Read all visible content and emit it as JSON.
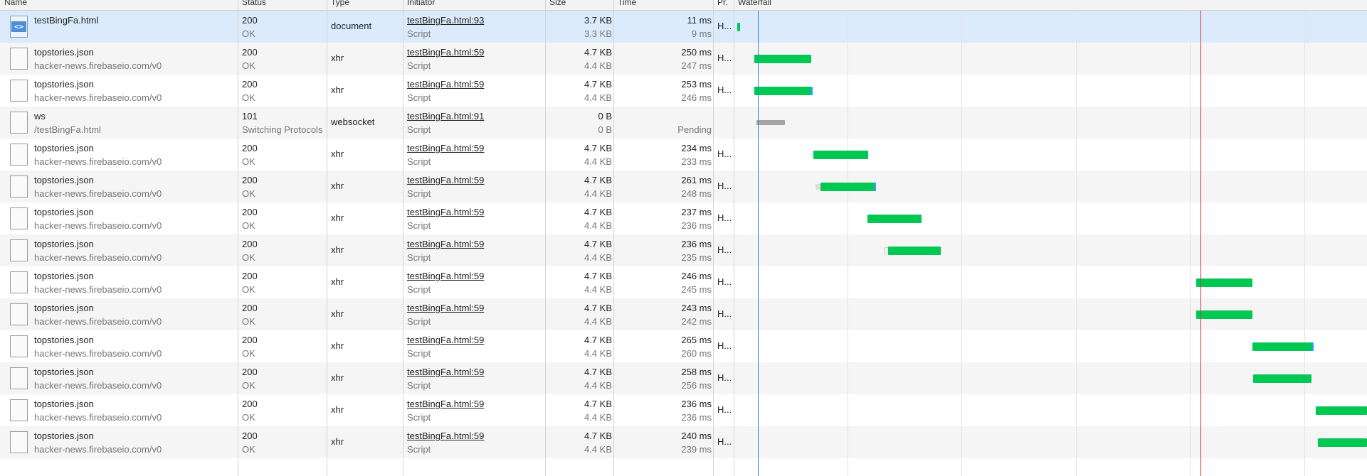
{
  "headers": {
    "name": "Name",
    "status": "Status",
    "type": "Type",
    "initiator": "Initiator",
    "size": "Size",
    "time": "Time",
    "protocol": "Pr.",
    "waterfall": "Waterfall"
  },
  "requests": [
    {
      "name": "testBingFa.html",
      "domain": "",
      "status": "200",
      "status_text": "OK",
      "type": "document",
      "initiator": "testBingFa.html:93",
      "initiator_type": "Script",
      "size": "3.7 KB",
      "resource": "3.3 KB",
      "time": "11 ms",
      "latency": "9 ms",
      "protocol": "H...",
      "icon": "html-document-icon"
    },
    {
      "name": "topstories.json",
      "domain": "hacker-news.firebaseio.com/v0",
      "status": "200",
      "status_text": "OK",
      "type": "xhr",
      "initiator": "testBingFa.html:59",
      "initiator_type": "Script",
      "size": "4.7 KB",
      "resource": "4.4 KB",
      "time": "250 ms",
      "latency": "247 ms",
      "protocol": "H...",
      "icon": "blank-file-icon"
    },
    {
      "name": "topstories.json",
      "domain": "hacker-news.firebaseio.com/v0",
      "status": "200",
      "status_text": "OK",
      "type": "xhr",
      "initiator": "testBingFa.html:59",
      "initiator_type": "Script",
      "size": "4.7 KB",
      "resource": "4.4 KB",
      "time": "253 ms",
      "latency": "246 ms",
      "protocol": "H...",
      "icon": "blank-file-icon"
    },
    {
      "name": "ws",
      "domain": "/testBingFa.html",
      "status": "101",
      "status_text": "Switching Protocols",
      "type": "websocket",
      "initiator": "testBingFa.html:91",
      "initiator_type": "Script",
      "size": "0 B",
      "resource": "0 B",
      "time": "",
      "latency": "Pending",
      "protocol": "",
      "icon": "blank-file-icon"
    },
    {
      "name": "topstories.json",
      "domain": "hacker-news.firebaseio.com/v0",
      "status": "200",
      "status_text": "OK",
      "type": "xhr",
      "initiator": "testBingFa.html:59",
      "initiator_type": "Script",
      "size": "4.7 KB",
      "resource": "4.4 KB",
      "time": "234 ms",
      "latency": "233 ms",
      "protocol": "H...",
      "icon": "blank-file-icon"
    },
    {
      "name": "topstories.json",
      "domain": "hacker-news.firebaseio.com/v0",
      "status": "200",
      "status_text": "OK",
      "type": "xhr",
      "initiator": "testBingFa.html:59",
      "initiator_type": "Script",
      "size": "4.7 KB",
      "resource": "4.4 KB",
      "time": "261 ms",
      "latency": "248 ms",
      "protocol": "H...",
      "icon": "blank-file-icon"
    },
    {
      "name": "topstories.json",
      "domain": "hacker-news.firebaseio.com/v0",
      "status": "200",
      "status_text": "OK",
      "type": "xhr",
      "initiator": "testBingFa.html:59",
      "initiator_type": "Script",
      "size": "4.7 KB",
      "resource": "4.4 KB",
      "time": "237 ms",
      "latency": "236 ms",
      "protocol": "H...",
      "icon": "blank-file-icon"
    },
    {
      "name": "topstories.json",
      "domain": "hacker-news.firebaseio.com/v0",
      "status": "200",
      "status_text": "OK",
      "type": "xhr",
      "initiator": "testBingFa.html:59",
      "initiator_type": "Script",
      "size": "4.7 KB",
      "resource": "4.4 KB",
      "time": "236 ms",
      "latency": "235 ms",
      "protocol": "H...",
      "icon": "blank-file-icon"
    },
    {
      "name": "topstories.json",
      "domain": "hacker-news.firebaseio.com/v0",
      "status": "200",
      "status_text": "OK",
      "type": "xhr",
      "initiator": "testBingFa.html:59",
      "initiator_type": "Script",
      "size": "4.7 KB",
      "resource": "4.4 KB",
      "time": "246 ms",
      "latency": "245 ms",
      "protocol": "H...",
      "icon": "blank-file-icon"
    },
    {
      "name": "topstories.json",
      "domain": "hacker-news.firebaseio.com/v0",
      "status": "200",
      "status_text": "OK",
      "type": "xhr",
      "initiator": "testBingFa.html:59",
      "initiator_type": "Script",
      "size": "4.7 KB",
      "resource": "4.4 KB",
      "time": "243 ms",
      "latency": "242 ms",
      "protocol": "H...",
      "icon": "blank-file-icon"
    },
    {
      "name": "topstories.json",
      "domain": "hacker-news.firebaseio.com/v0",
      "status": "200",
      "status_text": "OK",
      "type": "xhr",
      "initiator": "testBingFa.html:59",
      "initiator_type": "Script",
      "size": "4.7 KB",
      "resource": "4.4 KB",
      "time": "265 ms",
      "latency": "260 ms",
      "protocol": "H...",
      "icon": "blank-file-icon"
    },
    {
      "name": "topstories.json",
      "domain": "hacker-news.firebaseio.com/v0",
      "status": "200",
      "status_text": "OK",
      "type": "xhr",
      "initiator": "testBingFa.html:59",
      "initiator_type": "Script",
      "size": "4.7 KB",
      "resource": "4.4 KB",
      "time": "258 ms",
      "latency": "256 ms",
      "protocol": "H...",
      "icon": "blank-file-icon"
    },
    {
      "name": "topstories.json",
      "domain": "hacker-news.firebaseio.com/v0",
      "status": "200",
      "status_text": "OK",
      "type": "xhr",
      "initiator": "testBingFa.html:59",
      "initiator_type": "Script",
      "size": "4.7 KB",
      "resource": "4.4 KB",
      "time": "236 ms",
      "latency": "236 ms",
      "protocol": "H...",
      "icon": "blank-file-icon"
    },
    {
      "name": "topstories.json",
      "domain": "hacker-news.firebaseio.com/v0",
      "status": "200",
      "status_text": "OK",
      "type": "xhr",
      "initiator": "testBingFa.html:59",
      "initiator_type": "Script",
      "size": "4.7 KB",
      "resource": "4.4 KB",
      "time": "240 ms",
      "latency": "239 ms",
      "protocol": "H...",
      "icon": "blank-file-icon"
    }
  ],
  "selected_row": 0,
  "colors": {
    "selected_row": "#dcebfc",
    "bar_download": "#00c853",
    "bar_waiting": "#a6a6a6",
    "dom_content_loaded_line": "#2a7fdb",
    "load_line": "#d9302c"
  }
}
